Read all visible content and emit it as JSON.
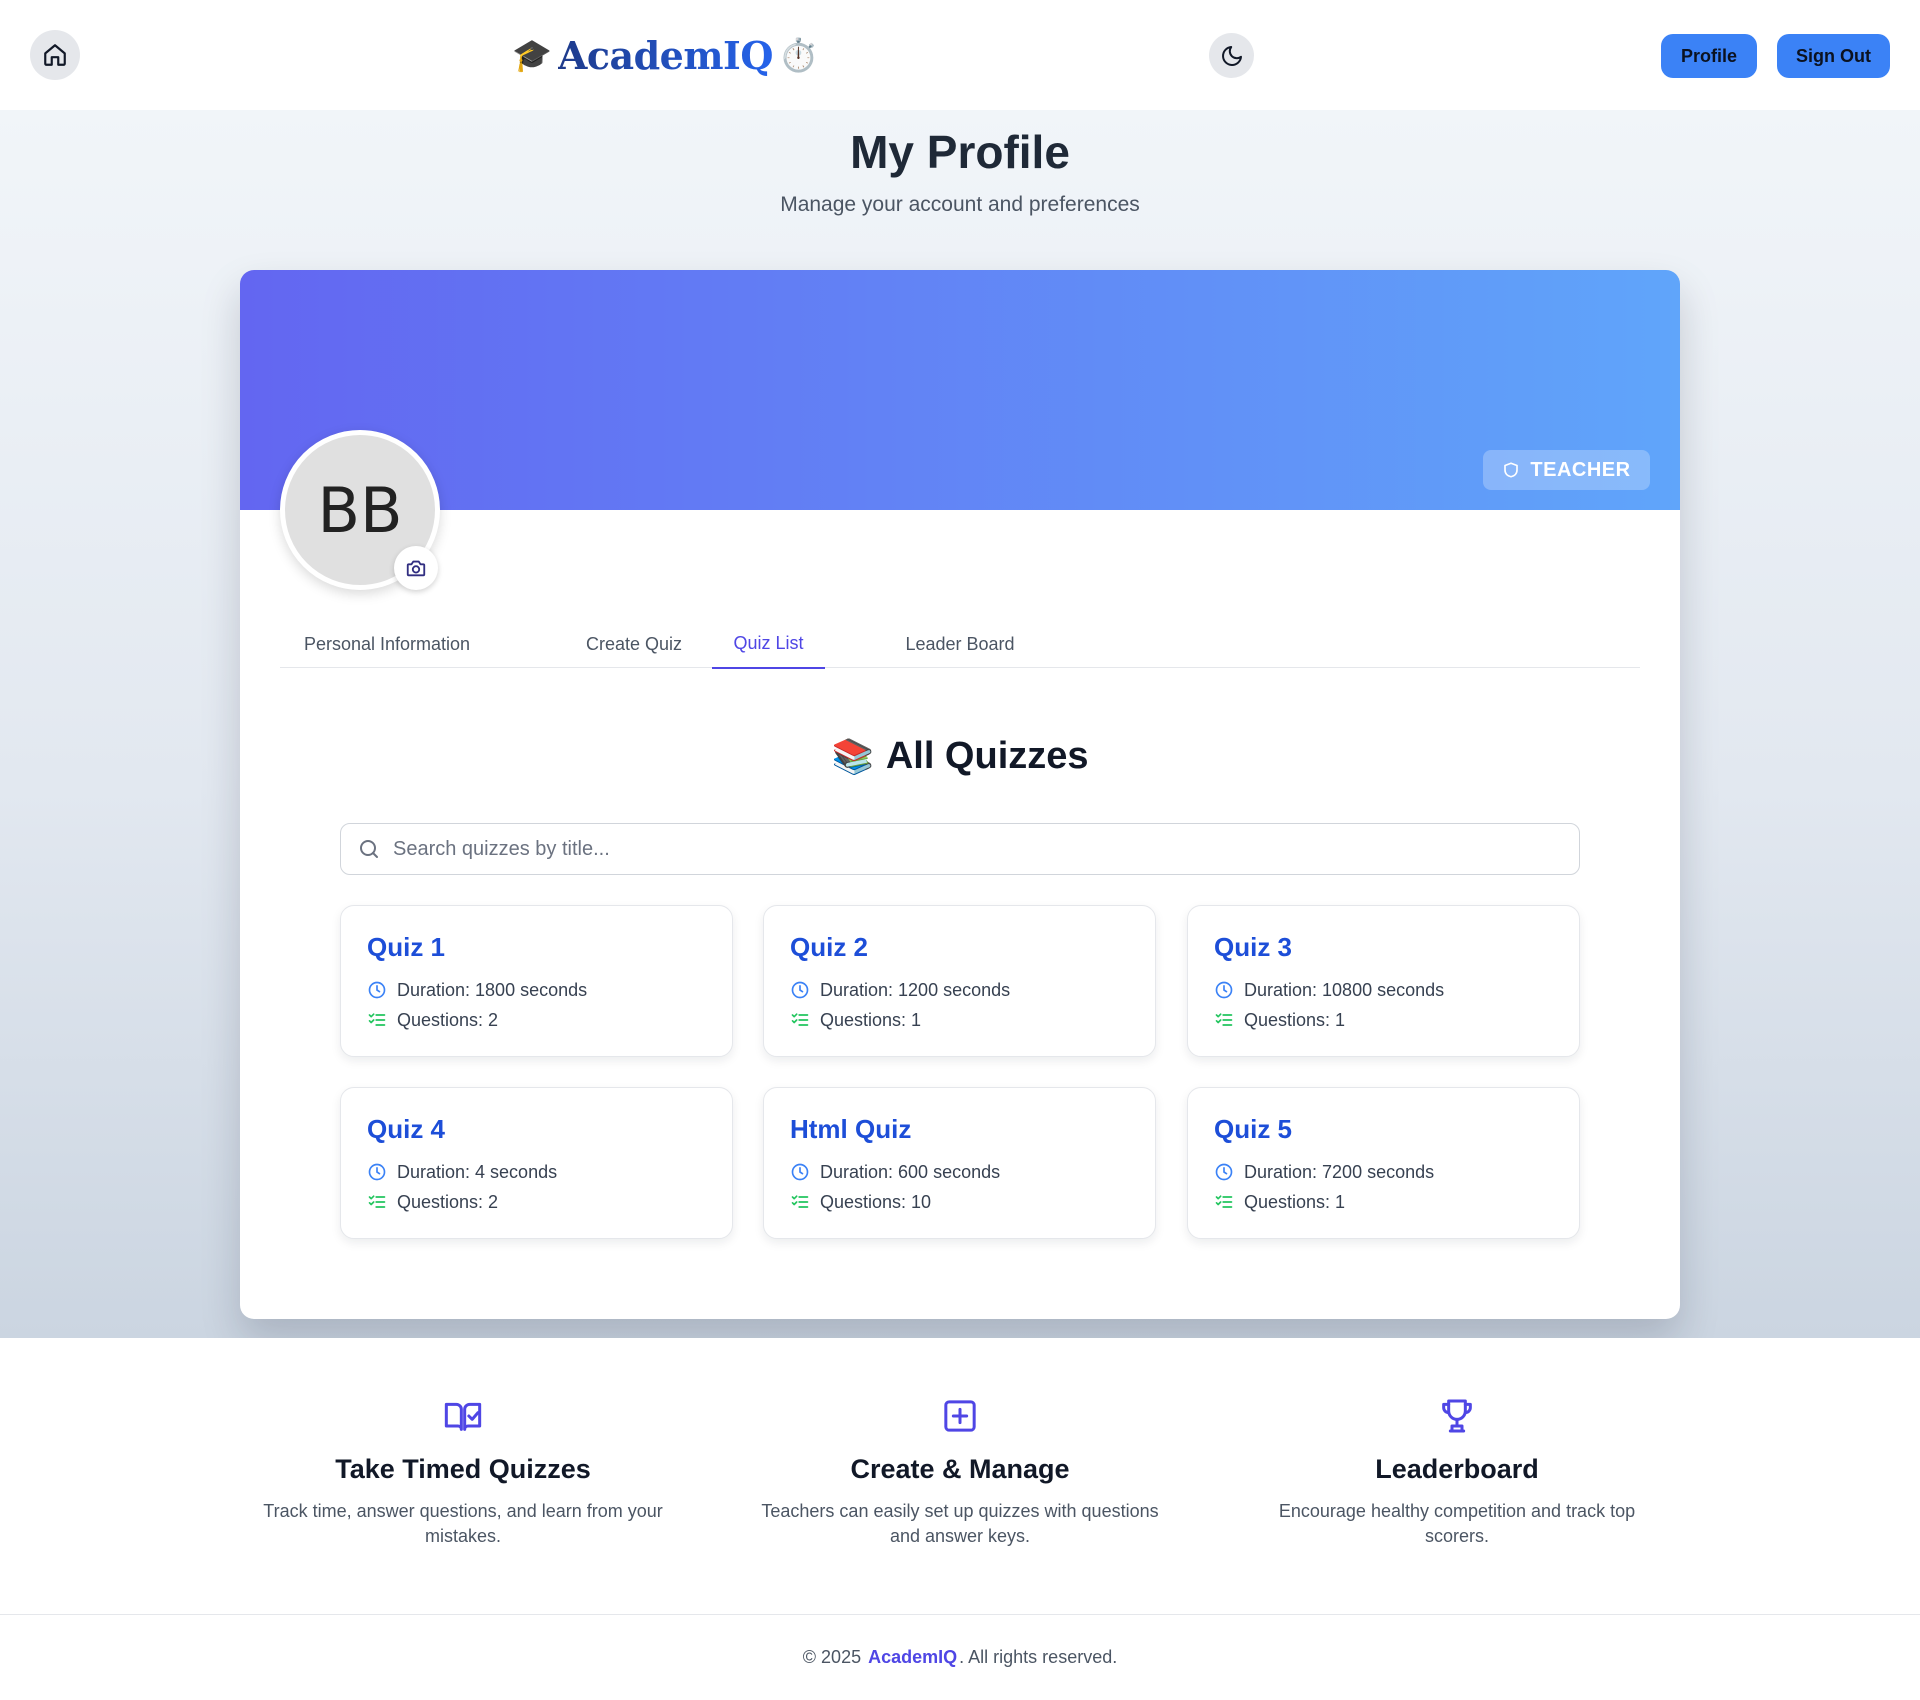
{
  "navbar": {
    "brand_prefix_emoji": "🎓",
    "brand_name": "AcademIQ",
    "brand_suffix_emoji": "⏱️",
    "profile_label": "Profile",
    "signout_label": "Sign Out",
    "icons": {
      "home": "home-icon",
      "theme": "moon-icon"
    }
  },
  "page": {
    "title": "My Profile",
    "subtitle": "Manage your account and preferences"
  },
  "profile": {
    "initials": "BB",
    "role": "TEACHER",
    "role_icon": "shield-icon",
    "camera_icon": "camera-icon"
  },
  "tabs": [
    {
      "label": "Personal Information",
      "active": false
    },
    {
      "label": "Create Quiz",
      "active": false
    },
    {
      "label": "Quiz List",
      "active": true
    },
    {
      "label": "Leader Board",
      "active": false
    }
  ],
  "quiz_list": {
    "emoji": "📚",
    "title": "All Quizzes",
    "search_placeholder": "Search quizzes by title...",
    "quizzes": [
      {
        "title": "Quiz 1",
        "duration": "Duration: 1800 seconds",
        "questions": "Questions: 2"
      },
      {
        "title": "Quiz 2",
        "duration": "Duration: 1200 seconds",
        "questions": "Questions: 1"
      },
      {
        "title": "Quiz 3",
        "duration": "Duration: 10800 seconds",
        "questions": "Questions: 1"
      },
      {
        "title": "Quiz 4",
        "duration": "Duration: 4 seconds",
        "questions": "Questions: 2"
      },
      {
        "title": "Html Quiz",
        "duration": "Duration: 600 seconds",
        "questions": "Questions: 10"
      },
      {
        "title": "Quiz 5",
        "duration": "Duration: 7200 seconds",
        "questions": "Questions: 1"
      }
    ]
  },
  "features": [
    {
      "icon": "book-check-icon",
      "title": "Take Timed Quizzes",
      "desc": "Track time, answer questions, and learn from your mistakes."
    },
    {
      "icon": "plus-square-icon",
      "title": "Create & Manage",
      "desc": "Teachers can easily set up quizzes with questions and answer keys."
    },
    {
      "icon": "trophy-icon",
      "title": "Leaderboard",
      "desc": "Encourage healthy competition and track top scorers."
    }
  ],
  "footer": {
    "prefix": "© 2025",
    "brand": "AcademIQ",
    "suffix": ". All rights reserved."
  },
  "colors": {
    "accent": "#3b82f6",
    "indigo": "#4f46e5",
    "quiz_title": "#1d4ed8",
    "banner_start": "#6366f1",
    "banner_end": "#60a5fa",
    "check_green": "#22c55e"
  }
}
